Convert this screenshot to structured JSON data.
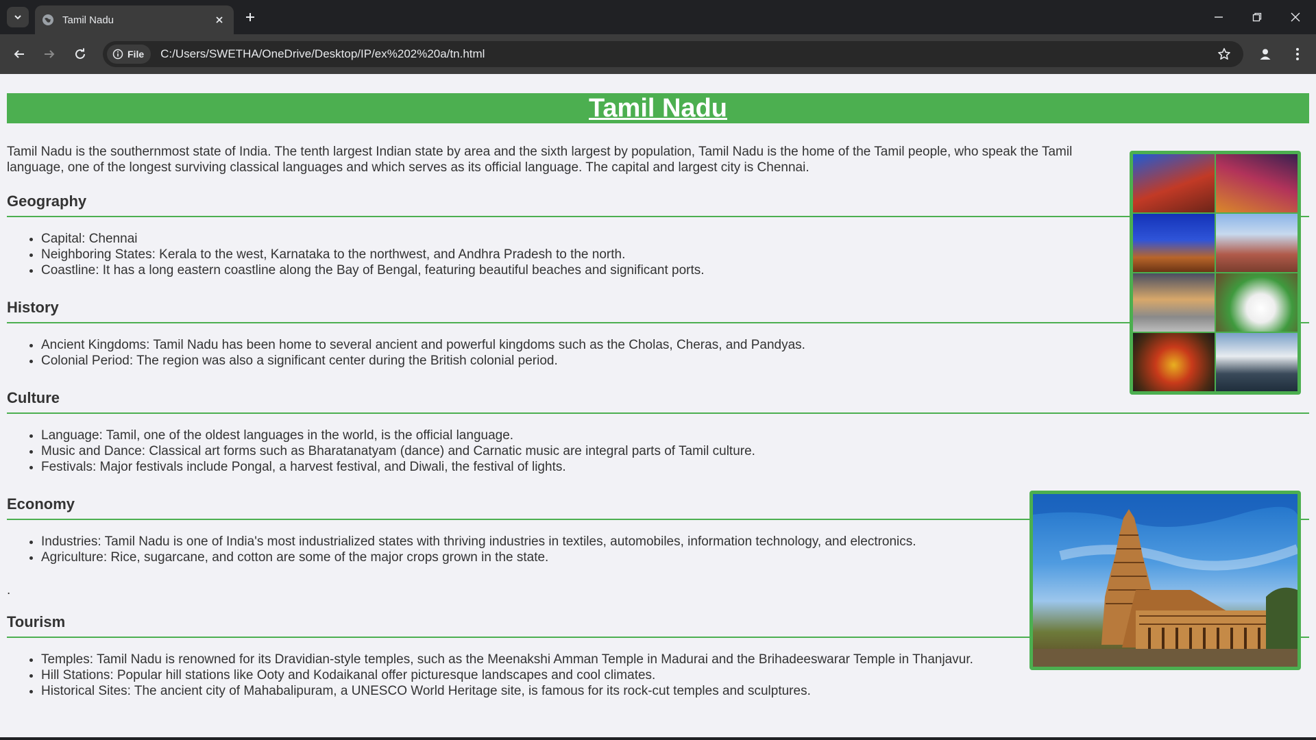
{
  "browser": {
    "tab_title": "Tamil Nadu",
    "security_chip_label": "File",
    "url": "C:/Users/SWETHA/OneDrive/Desktop/IP/ex%202%20a/tn.html"
  },
  "page": {
    "heading": "Tamil Nadu",
    "intro": "Tamil Nadu is the southernmost state of India. The tenth largest Indian state by area and the sixth largest by population, Tamil Nadu is the home of the Tamil people, who speak the Tamil language, one of the longest surviving classical languages and which serves as its official language. The capital and largest city is Chennai.",
    "sections": [
      {
        "title": "Geography",
        "items": [
          "Capital: Chennai",
          "Neighboring States: Kerala to the west, Karnataka to the northwest, and Andhra Pradesh to the north.",
          "Coastline: It has a long eastern coastline along the Bay of Bengal, featuring beautiful beaches and significant ports."
        ]
      },
      {
        "title": "History",
        "items": [
          "Ancient Kingdoms: Tamil Nadu has been home to several ancient and powerful kingdoms such as the Cholas, Cheras, and Pandyas.",
          "Colonial Period: The region was also a significant center during the British colonial period."
        ]
      },
      {
        "title": "Culture",
        "items": [
          "Language: Tamil, one of the oldest languages in the world, is the official language.",
          "Music and Dance: Classical art forms such as Bharatanatyam (dance) and Carnatic music are integral parts of Tamil culture.",
          "Festivals: Major festivals include Pongal, a harvest festival, and Diwali, the festival of lights."
        ]
      },
      {
        "title": "Economy",
        "items": [
          "Industries: Tamil Nadu is one of India's most industrialized states with thriving industries in textiles, automobiles, information technology, and electronics.",
          "Agriculture: Rice, sugarcane, and cotton are some of the major crops grown in the state."
        ]
      },
      {
        "title": "Tourism",
        "items": [
          "Temples: Tamil Nadu is renowned for its Dravidian-style temples, such as the Meenakshi Amman Temple in Madurai and the Brihadeeswarar Temple in Thanjavur.",
          "Hill Stations: Popular hill stations like Ooty and Kodaikanal offer picturesque landscapes and cool climates.",
          "Historical Sites: The ancient city of Mahabalipuram, a UNESCO World Heritage site, is famous for its rock-cut temples and sculptures."
        ]
      }
    ],
    "stray_text": "."
  },
  "colors": {
    "accent_green": "#4caf50",
    "page_bg": "#f2f2f6",
    "chrome_dark": "#202124",
    "chrome_toolbar": "#3c3c3c"
  },
  "icons": {
    "tab_search": "chevron-down-icon",
    "favicon": "globe-icon",
    "tab_close": "close-icon",
    "new_tab": "plus-icon",
    "minimize": "minimize-icon",
    "restore": "restore-icon",
    "close_window": "close-icon",
    "back": "arrow-left-icon",
    "forward": "arrow-right-icon",
    "reload": "reload-icon",
    "info": "info-icon",
    "bookmark": "star-icon",
    "profile": "profile-icon",
    "menu": "kebab-menu-icon"
  }
}
